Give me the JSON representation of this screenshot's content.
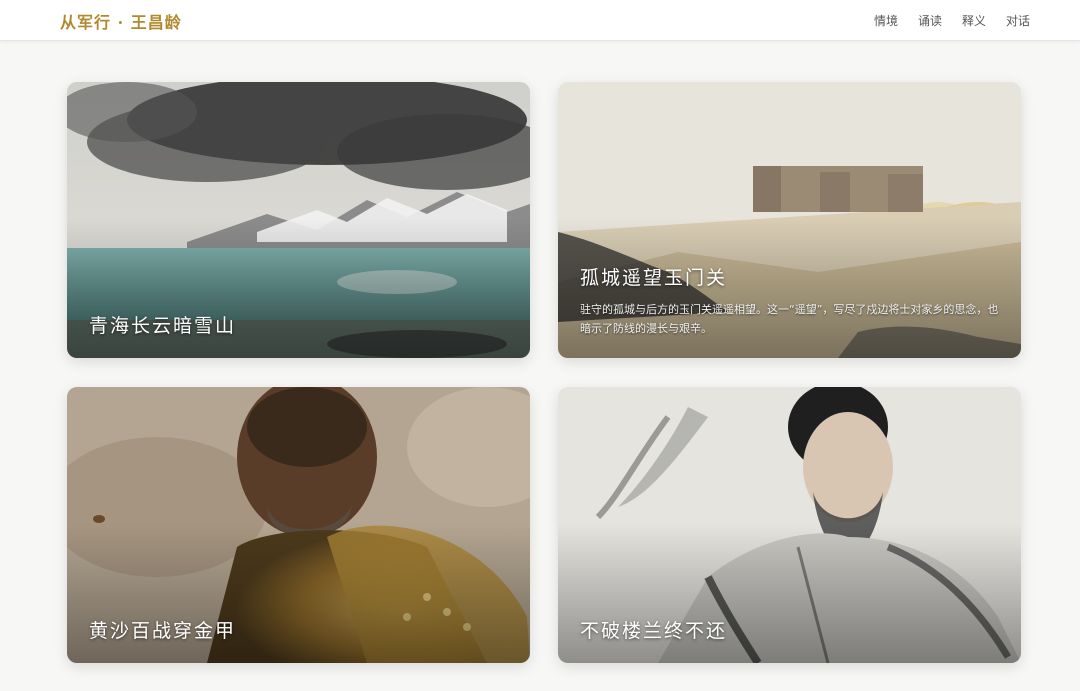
{
  "header": {
    "brand": "从军行 · 王昌龄",
    "nav": [
      "情境",
      "诵读",
      "释义",
      "对话"
    ]
  },
  "cards": [
    {
      "title": "青海长云暗雪山",
      "description": ""
    },
    {
      "title": "孤城遥望玉门关",
      "description": "驻守的孤城与后方的玉门关遥遥相望。这一“遥望”，写尽了戍边将士对家乡的思念，也暗示了防线的漫长与艰辛。"
    },
    {
      "title": "黄沙百战穿金甲",
      "description": ""
    },
    {
      "title": "不破楼兰终不还",
      "description": ""
    }
  ],
  "colors": {
    "brand": "#b08a2e"
  }
}
